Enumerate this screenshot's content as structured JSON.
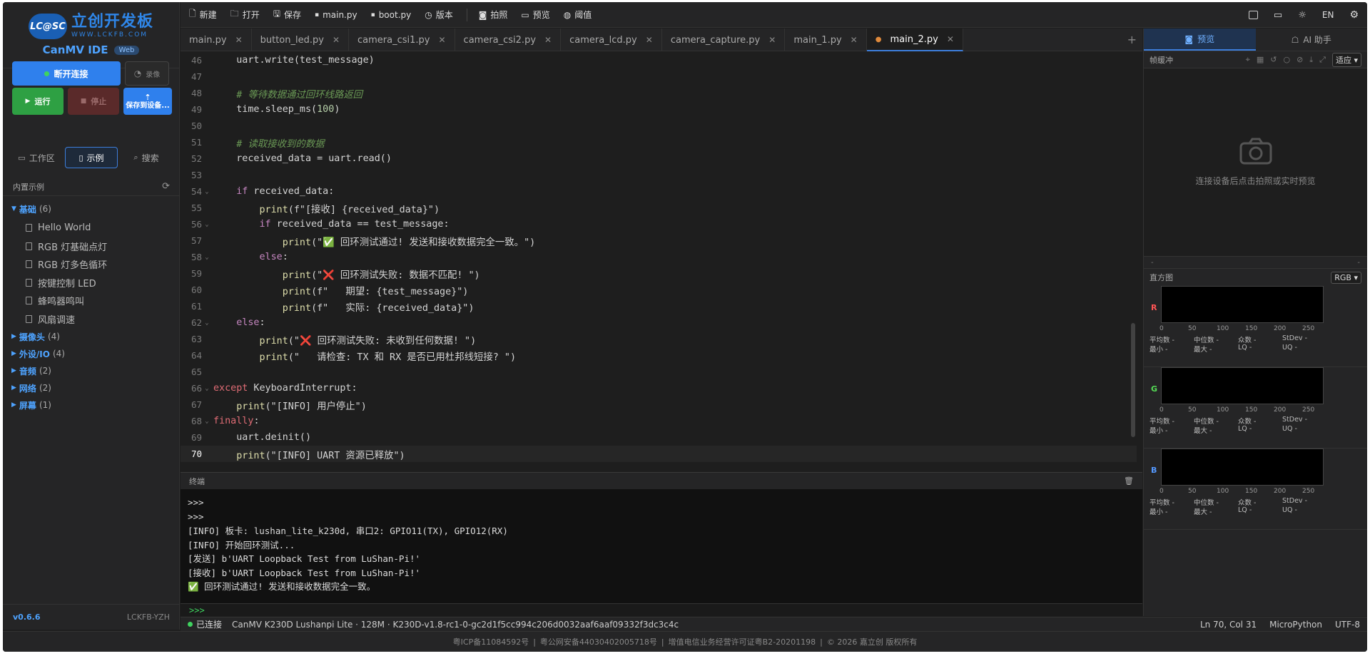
{
  "brand": {
    "badge": "LC@SC",
    "name_cn": "立创开发板",
    "url": "WWW.LCKFB.COM",
    "ide": "CanMV IDE",
    "web_badge": "Web"
  },
  "sidebar": {
    "disconnect": "断开连接",
    "record": "录像",
    "run": "运行",
    "stop": "停止",
    "save": "保存到设备...",
    "tabs": [
      "工作区",
      "示例",
      "搜索"
    ],
    "section": "内置示例",
    "categories": [
      {
        "name": "基础",
        "count": "(6)",
        "open": true,
        "files": [
          "Hello World",
          "RGB 灯基础点灯",
          "RGB 灯多色循环",
          "按键控制 LED",
          "蜂鸣器鸣叫",
          "风扇调速"
        ]
      },
      {
        "name": "摄像头",
        "count": "(4)"
      },
      {
        "name": "外设/IO",
        "count": "(4)"
      },
      {
        "name": "音频",
        "count": "(2)"
      },
      {
        "name": "网络",
        "count": "(2)"
      },
      {
        "name": "屏幕",
        "count": "(1)"
      }
    ],
    "version": "v0.6.6",
    "user": "LCKFB-YZH"
  },
  "toolbar": {
    "items": [
      "新建",
      "打开",
      "保存",
      "main.py",
      "boot.py",
      "版本",
      "拍照",
      "预览",
      "阈值"
    ],
    "lang": "EN"
  },
  "tabs": [
    {
      "name": "main.py"
    },
    {
      "name": "button_led.py"
    },
    {
      "name": "camera_csi1.py"
    },
    {
      "name": "camera_csi2.py"
    },
    {
      "name": "camera_lcd.py"
    },
    {
      "name": "camera_capture.py"
    },
    {
      "name": "main_1.py"
    },
    {
      "name": "main_2.py",
      "active": true
    }
  ],
  "code": [
    {
      "n": "46",
      "html": "    uart.write(test_message)"
    },
    {
      "n": "47",
      "html": ""
    },
    {
      "n": "48",
      "html": "    <span class='cmt'># 等待数据通过回环线路返回</span>"
    },
    {
      "n": "49",
      "html": "    time.sleep_ms(<span class='num'>100</span>)"
    },
    {
      "n": "50",
      "html": ""
    },
    {
      "n": "51",
      "html": "    <span class='cmt'># 读取接收到的数据</span>"
    },
    {
      "n": "52",
      "html": "    received_data = uart.read()"
    },
    {
      "n": "53",
      "html": ""
    },
    {
      "n": "54",
      "fold": true,
      "html": "    <span class='kw'>if</span> received_data:"
    },
    {
      "n": "55",
      "html": "        <span class='fn'>print</span>(f\"[接收] {received_data}\")"
    },
    {
      "n": "56",
      "fold": true,
      "html": "        <span class='kw'>if</span> received_data == test_message:"
    },
    {
      "n": "57",
      "html": "            <span class='fn'>print</span>(\"✅ 回环测试通过! 发送和接收数据完全一致。\")"
    },
    {
      "n": "58",
      "fold": true,
      "html": "        <span class='kw'>else</span>:"
    },
    {
      "n": "59",
      "html": "            <span class='fn'>print</span>(\"<span style='color:#ff4d4d'>❌</span> 回环测试失败: 数据不匹配! \")"
    },
    {
      "n": "60",
      "html": "            <span class='fn'>print</span>(f\"   期望: {test_message}\")"
    },
    {
      "n": "61",
      "html": "            <span class='fn'>print</span>(f\"   实际: {received_data}\")"
    },
    {
      "n": "62",
      "fold": true,
      "html": "    <span class='kw'>else</span>:"
    },
    {
      "n": "63",
      "html": "        <span class='fn'>print</span>(\"<span style='color:#ff4d4d'>❌</span> 回环测试失败: 未收到任何数据! \")"
    },
    {
      "n": "64",
      "html": "        <span class='fn'>print</span>(\"   请检查: TX 和 RX 是否已用杜邦线短接? \")"
    },
    {
      "n": "65",
      "html": ""
    },
    {
      "n": "66",
      "fold": true,
      "html": "<span class='kw2'>except</span> KeyboardInterrupt:"
    },
    {
      "n": "67",
      "html": "    <span class='fn'>print</span>(\"[INFO] 用户停止\")"
    },
    {
      "n": "68",
      "fold": true,
      "html": "<span class='kw2'>finally</span>:"
    },
    {
      "n": "69",
      "html": "    uart.deinit()"
    },
    {
      "n": "70",
      "current": true,
      "html": "    <span class='fn'>print</span>(\"[INFO] UART 资源已释放\")"
    }
  ],
  "terminal": {
    "title": "终端",
    "lines": [
      ">>>",
      ">>>",
      "[INFO] 板卡: lushan_lite_k230d, 串口2: GPIO11(TX), GPIO12(RX)",
      "[INFO] 开始回环测试...",
      "[发送] b'UART Loopback Test from LuShan-Pi!'",
      "[接收] b'UART Loopback Test from LuShan-Pi!'",
      "✅ 回环测试通过! 发送和接收数据完全一致。"
    ],
    "prompt": ">>>"
  },
  "status": {
    "connected": "已连接",
    "device": "CanMV K230D Lushanpi Lite · 128M · K230D-v1.8-rc1-0-gc2d1f5cc994c206d0032aaf6aaf09332f3dc3c4c",
    "position": "Ln 70, Col 31",
    "lang": "MicroPython",
    "encoding": "UTF-8"
  },
  "right": {
    "tabs": [
      "预览",
      "AI 助手"
    ],
    "fb_label": "帧缓冲",
    "fit": "适应",
    "preview_text": "连接设备后点击拍照或实时预览",
    "mini_left": "-",
    "mini_right": "-",
    "hist_label": "直方图",
    "hist_mode": "RGB",
    "axis": [
      "0",
      "50",
      "100",
      "150",
      "200",
      "250"
    ],
    "channels": [
      {
        "letter": "R",
        "color": "#ff5555"
      },
      {
        "letter": "G",
        "color": "#55dd55"
      },
      {
        "letter": "B",
        "color": "#5599ff"
      }
    ],
    "stats": {
      "row1": [
        "平均数",
        "中位数",
        "众数",
        "StDev"
      ],
      "row2": [
        "最小",
        "最大",
        "LQ",
        "UQ"
      ],
      "value": "-"
    }
  },
  "footer": [
    "粤ICP备11084592号",
    "粤公网安备44030402005718号",
    "增值电信业务经营许可证粤B2-20201198",
    "© 2026 嘉立创 版权所有"
  ]
}
